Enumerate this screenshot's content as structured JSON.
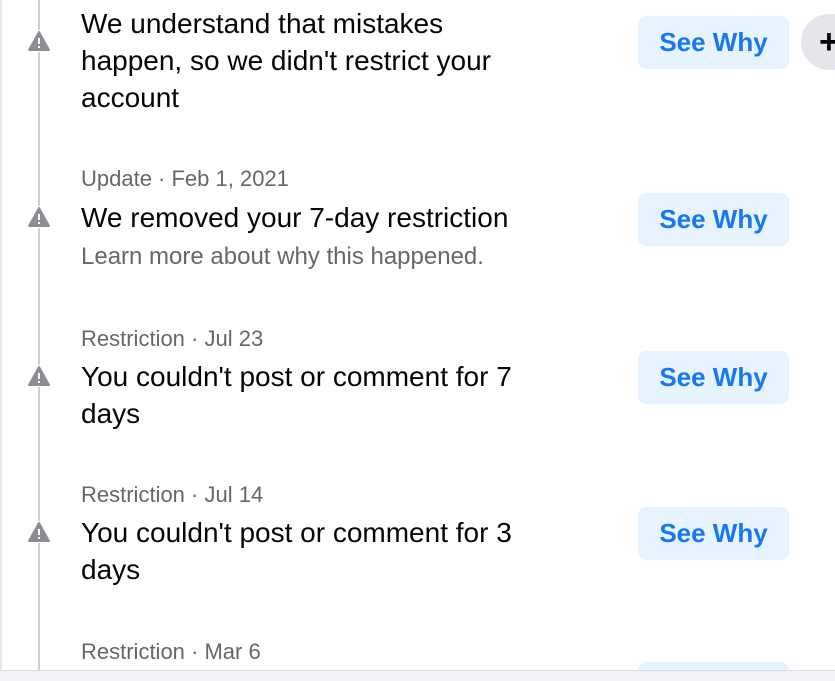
{
  "entries": [
    {
      "meta": "",
      "title_lines": [
        "We understand that mistakes",
        "happen, so we didn't restrict your",
        "account"
      ],
      "subtitle": "",
      "button": "See Why"
    },
    {
      "meta": "Update · Feb 1, 2021",
      "title_lines": [
        "We removed your 7-day restriction"
      ],
      "subtitle": "Learn more about why this happened.",
      "button": "See Why"
    },
    {
      "meta": "Restriction · Jul 23",
      "title_lines": [
        "You couldn't post or comment for 7",
        "days"
      ],
      "subtitle": "",
      "button": "See Why"
    },
    {
      "meta": "Restriction · Jul 14",
      "title_lines": [
        "You couldn't post or comment for 3",
        "days"
      ],
      "subtitle": "",
      "button": "See Why"
    },
    {
      "meta": "Restriction · Mar 6",
      "title_lines": [],
      "subtitle": "",
      "button": ""
    }
  ],
  "plus_button": "+",
  "colors": {
    "accent": "#1877f2",
    "button_bg": "#e7f3ff",
    "secondary_text": "#65676b",
    "icon": "#8a8d91"
  },
  "icons": {
    "warning": "warning-icon",
    "plus": "plus-icon"
  }
}
